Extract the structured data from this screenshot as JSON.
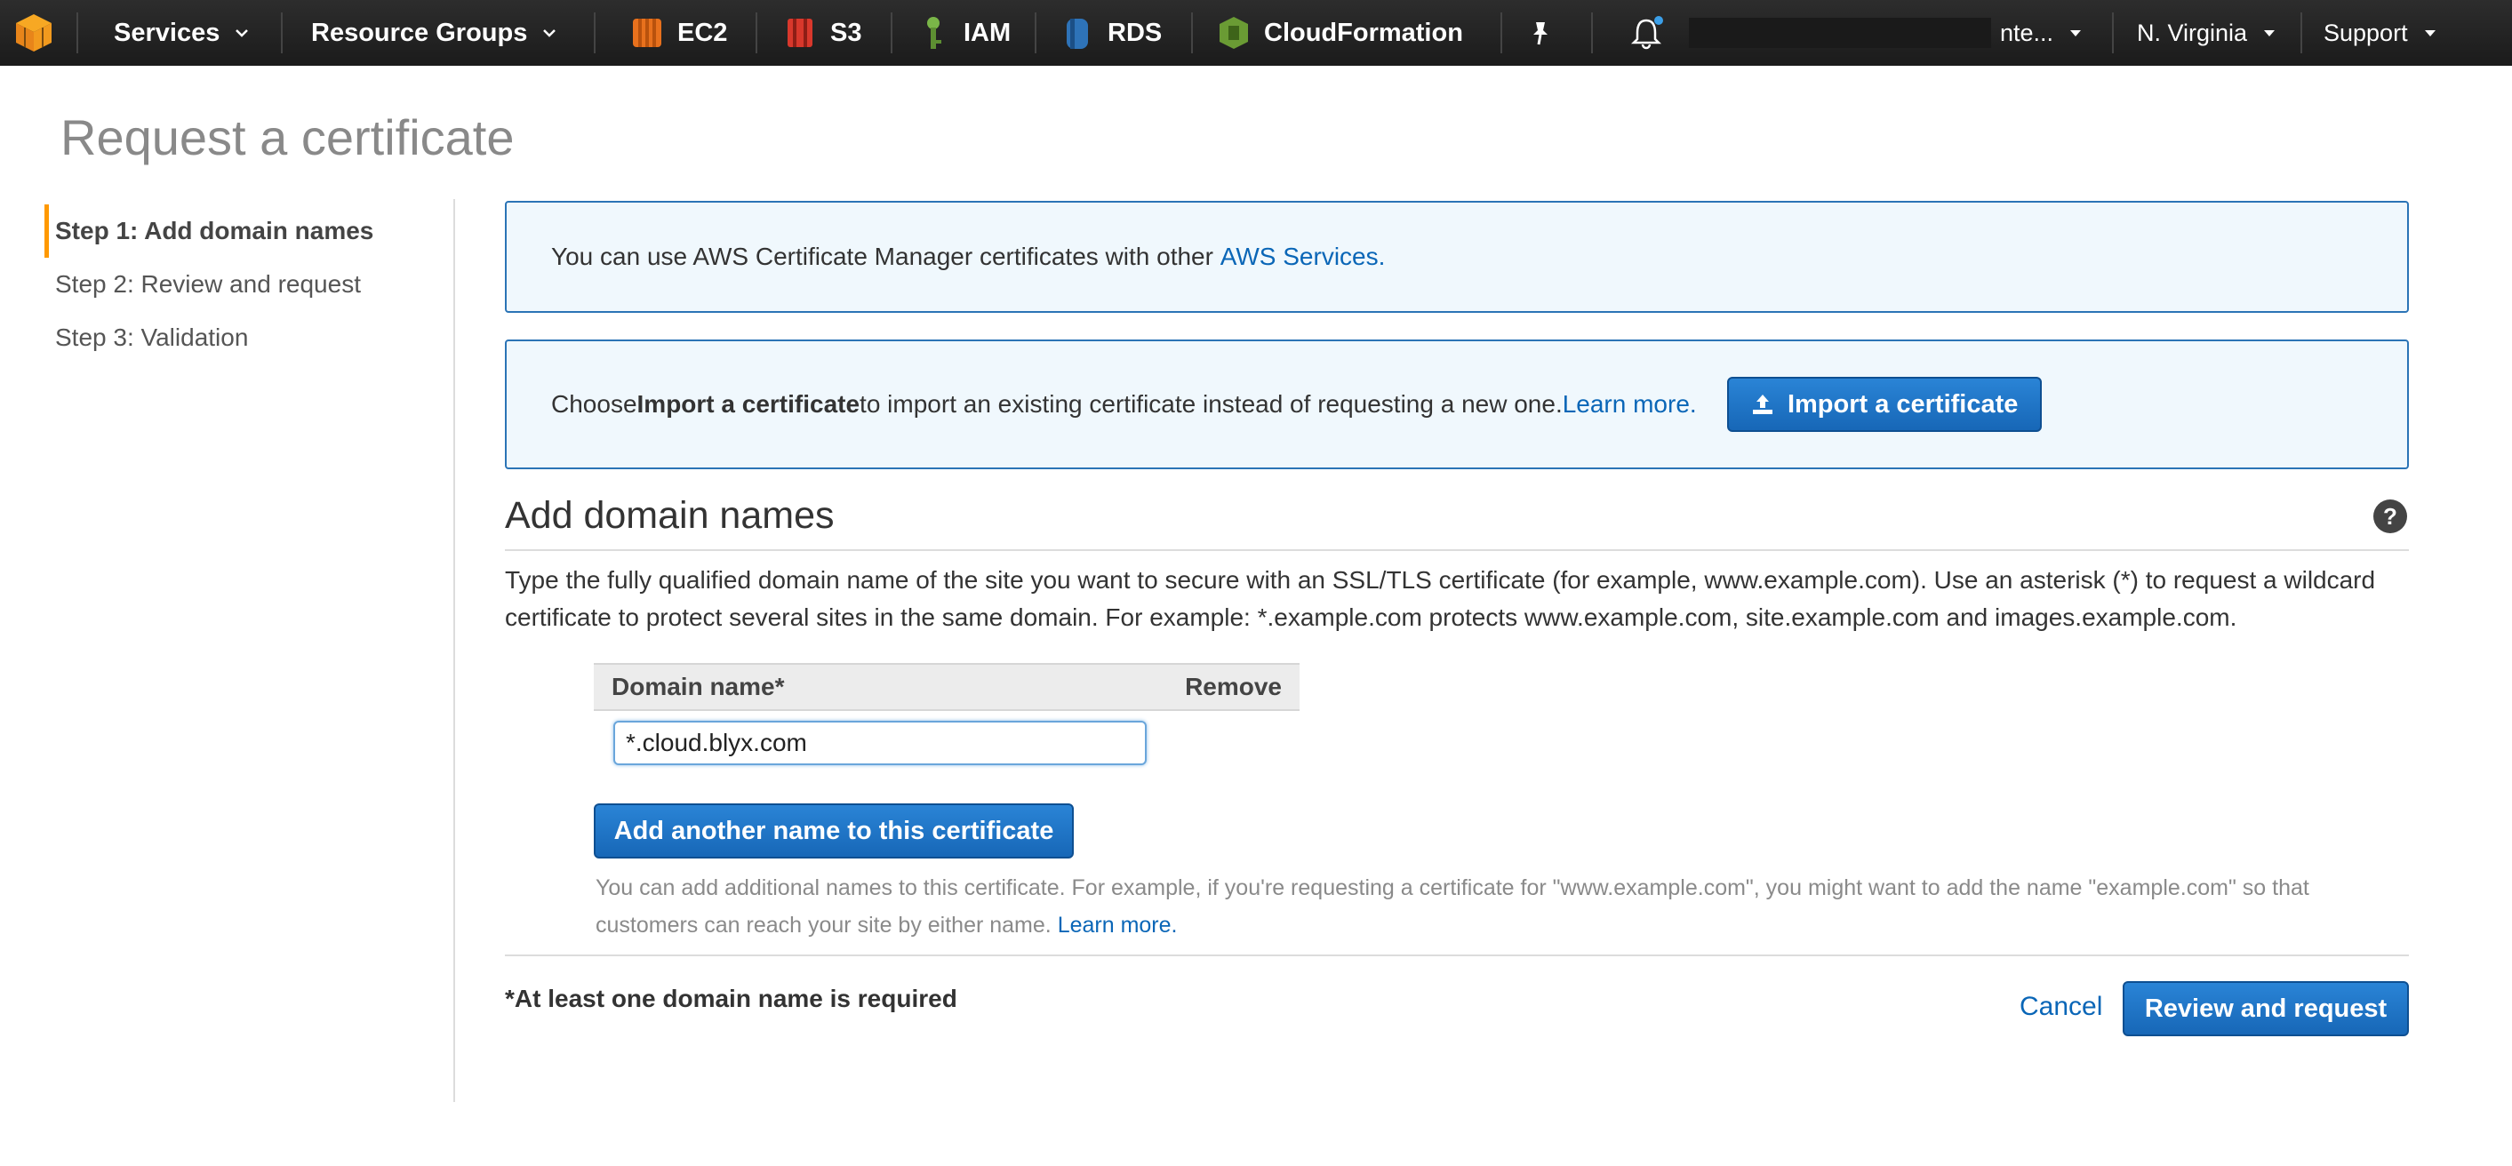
{
  "nav": {
    "services": "Services",
    "resource_groups": "Resource Groups",
    "ec2": "EC2",
    "s3": "S3",
    "iam": "IAM",
    "rds": "RDS",
    "cloudformation": "CloudFormation",
    "account": "nte...",
    "region": "N. Virginia",
    "support": "Support"
  },
  "page": {
    "title": "Request a certificate"
  },
  "steps": [
    {
      "label": "Step 1: Add domain names"
    },
    {
      "label": "Step 2: Review and request"
    },
    {
      "label": "Step 3: Validation"
    }
  ],
  "info1": {
    "text": "You can use AWS Certificate Manager certificates with other ",
    "link": "AWS Services."
  },
  "info2": {
    "text_before": "Choose ",
    "bold": "Import a certificate",
    "text_after": " to import an existing certificate instead of requesting a new one. ",
    "link": "Learn more.",
    "button": "Import a certificate"
  },
  "section": {
    "title": "Add domain names",
    "description": "Type the fully qualified domain name of the site you want to secure with an SSL/TLS certificate (for example, www.example.com). Use an asterisk (*) to request a wildcard certificate to protect several sites in the same domain. For example: *.example.com protects www.example.com, site.example.com and images.example.com."
  },
  "table": {
    "col_domain": "Domain name*",
    "col_remove": "Remove",
    "domain_value": "*.cloud.blyx.com"
  },
  "add_button": "Add another name to this certificate",
  "hint": {
    "text": "You can add additional names to this certificate. For example, if you're requesting a certificate for \"www.example.com\", you might want to add the name \"example.com\" so that customers can reach your site by either name. ",
    "link": "Learn more."
  },
  "footer": {
    "required": "*At least one domain name is required",
    "cancel": "Cancel",
    "review": "Review and request"
  },
  "colors": {
    "nav_bg": "#232f3e",
    "accent_orange": "#ff9900",
    "button_blue": "#1767b7",
    "link_blue": "#0a66b7",
    "info_bg": "#f0f8fd"
  }
}
